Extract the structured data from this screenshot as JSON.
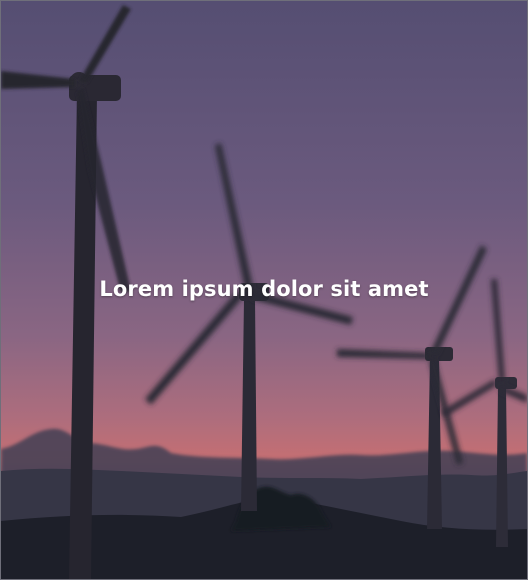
{
  "caption": {
    "text": "Lorem ipsum dolor sit amet"
  },
  "scene": {
    "subject": "wind-turbines-at-sunset",
    "colors": {
      "sky_top": "#5b5276",
      "sky_mid": "#7c6482",
      "horizon_glow": "#c86f74",
      "mountains": "#3b3a4c",
      "ground": "#1f222c",
      "turbines": "#2a2a37",
      "caption": "#ffffff",
      "frame_border": "#6f6f7a"
    }
  }
}
